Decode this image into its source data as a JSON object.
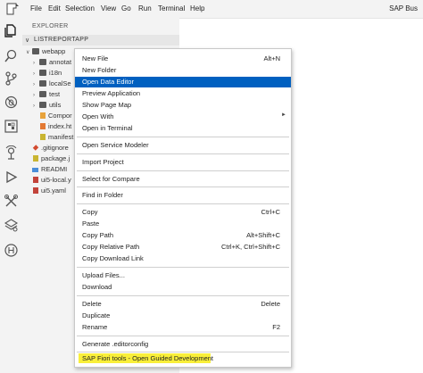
{
  "menubar": {
    "items": [
      "File",
      "Edit",
      "Selection",
      "View",
      "Go",
      "Run",
      "Terminal",
      "Help"
    ],
    "title_right": "SAP Bus"
  },
  "activitybar": {
    "icons": [
      "files-icon",
      "search-icon",
      "source-control-icon",
      "debug-icon",
      "extensions-icon",
      "remote-icon",
      "run-icon",
      "tools-icon",
      "layers-icon",
      "api-icon"
    ]
  },
  "sidebar": {
    "title": "EXPLORER",
    "project": "LISTREPORTAPP",
    "tree": [
      {
        "label": "webapp",
        "type": "folder",
        "expanded": true
      },
      {
        "label": "annotat",
        "type": "folder"
      },
      {
        "label": "i18n",
        "type": "folder"
      },
      {
        "label": "localSe",
        "type": "folder"
      },
      {
        "label": "test",
        "type": "folder"
      },
      {
        "label": "utils",
        "type": "folder"
      },
      {
        "label": "Compor",
        "type": "xml"
      },
      {
        "label": "index.ht",
        "type": "html"
      },
      {
        "label": "manifest",
        "type": "json"
      },
      {
        "label": ".gitignore",
        "type": "git"
      },
      {
        "label": "package.j",
        "type": "json"
      },
      {
        "label": "READMI",
        "type": "md"
      },
      {
        "label": "ui5-local.y",
        "type": "yaml"
      },
      {
        "label": "ui5.yaml",
        "type": "yaml"
      }
    ]
  },
  "context_menu": {
    "groups": [
      [
        {
          "label": "New File",
          "shortcut": "Alt+N"
        },
        {
          "label": "New Folder",
          "shortcut": ""
        },
        {
          "label": "Open Data Editor",
          "shortcut": "",
          "active": true
        },
        {
          "label": "Preview Application",
          "shortcut": ""
        },
        {
          "label": "Show Page Map",
          "shortcut": ""
        },
        {
          "label": "Open With",
          "shortcut": "",
          "submenu": true
        },
        {
          "label": "Open in Terminal",
          "shortcut": ""
        }
      ],
      [
        {
          "label": "Open Service Modeler",
          "shortcut": ""
        }
      ],
      [
        {
          "label": "Import Project",
          "shortcut": ""
        }
      ],
      [
        {
          "label": "Select for Compare",
          "shortcut": ""
        }
      ],
      [
        {
          "label": "Find in Folder",
          "shortcut": ""
        }
      ],
      [
        {
          "label": "Copy",
          "shortcut": "Ctrl+C"
        },
        {
          "label": "Paste",
          "shortcut": ""
        },
        {
          "label": "Copy Path",
          "shortcut": "Alt+Shift+C"
        },
        {
          "label": "Copy Relative Path",
          "shortcut": "Ctrl+K, Ctrl+Shift+C"
        },
        {
          "label": "Copy Download Link",
          "shortcut": ""
        }
      ],
      [
        {
          "label": "Upload Files...",
          "shortcut": ""
        },
        {
          "label": "Download",
          "shortcut": ""
        }
      ],
      [
        {
          "label": "Delete",
          "shortcut": "Delete"
        },
        {
          "label": "Duplicate",
          "shortcut": ""
        },
        {
          "label": "Rename",
          "shortcut": "F2"
        }
      ],
      [
        {
          "label": "Generate .editorconfig",
          "shortcut": ""
        }
      ],
      [
        {
          "label": "SAP Fiori tools - Open Guided Development",
          "shortcut": "",
          "highlighted": true
        }
      ]
    ]
  },
  "colors": {
    "active_item": "#0060c0",
    "highlight": "#f9ef3a"
  }
}
